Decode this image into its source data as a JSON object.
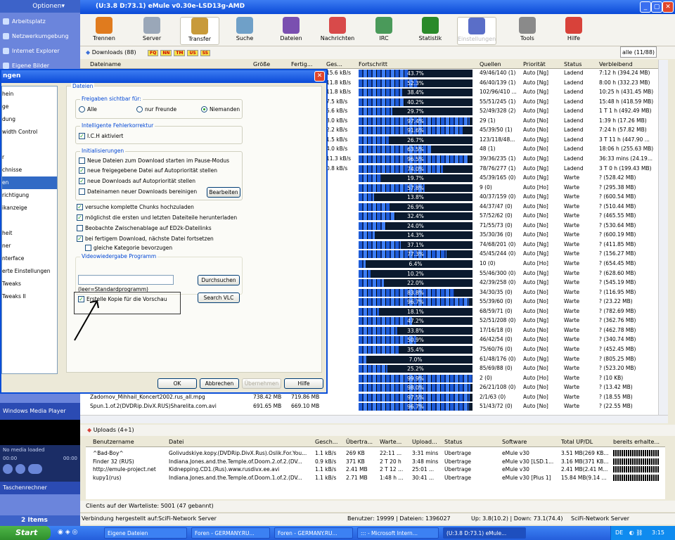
{
  "window": {
    "title": "(U:3.8 D:73.1) eMule v0.30e-LSD13g-AMD"
  },
  "explorer": {
    "optionen": "Optionen▾",
    "items": [
      "Arbeitsplatz",
      "Netzwerkumgebung",
      "Internet Explorer",
      "Eigene Bilder"
    ],
    "wmp_title": "Windows Media Player",
    "wmp_media": "No media loaded",
    "wmp_time_left": "00:00",
    "wmp_time_right": "00:00",
    "taschenrechner": "Taschenrechner",
    "items_count": "2 Items"
  },
  "toolbar": [
    "Trennen",
    "Server",
    "Transfer",
    "Suche",
    "Dateien",
    "Nachrichten",
    "IRC",
    "Statistik",
    "Einstellungen",
    "Tools",
    "Hilfe"
  ],
  "downloads": {
    "header": "Downloads (88)",
    "badges": [
      "FQ",
      "NN",
      "TM",
      "US",
      "SS"
    ],
    "filter": "alle (11/88)",
    "columns": [
      "Dateiname",
      "Größe",
      "Fertig...",
      "Ges...",
      "Fortschritt",
      "Quellen",
      "Priorität",
      "Status",
      "Verbleibend"
    ],
    "rows": [
      [
        "",
        "",
        "",
        "15.6 kB/s",
        "43.7%",
        "49/46/140 (1)",
        "Auto [Ng]",
        "Ladend",
        "7:12 h (394.24 MB)",
        43.7
      ],
      [
        "",
        "",
        "",
        "11.8 kB/s",
        "52.3%",
        "46/40/139 (1)",
        "Auto [Ng]",
        "Ladend",
        "8:00 h (332.23 MB)",
        52.3
      ],
      [
        "",
        "",
        "",
        "11.8 kB/s",
        "38.4%",
        "102/96/410 ...",
        "Auto [Ng]",
        "Ladend",
        "10:25 h (431.45 MB)",
        38.4
      ],
      [
        "",
        "",
        "",
        "7.5 kB/s",
        "40.2%",
        "55/51/245 (1)",
        "Auto [Ng]",
        "Ladend",
        "15:48 h (418.59 MB)",
        40.2
      ],
      [
        "",
        "",
        "",
        "5.6 kB/s",
        "29.7%",
        "52/49/328 (2)",
        "Auto [Ng]",
        "Ladend",
        "1 T 1 h (492.49 MB)",
        29.7
      ],
      [
        "",
        "",
        "",
        "3.0 kB/s",
        "97.4%",
        "29 (1)",
        "Auto [No]",
        "Ladend",
        "1:39 h (17.26 MB)",
        97.4
      ],
      [
        "",
        "",
        "",
        "2.2 kB/s",
        "91.6%",
        "45/39/50 (1)",
        "Auto [No]",
        "Ladend",
        "7:24 h (57.82 MB)",
        91.6
      ],
      [
        "",
        "",
        "",
        "1.5 kB/s",
        "26.7%",
        "123/118/48...",
        "Auto [Ng]",
        "Ladend",
        "3 T 11 h (447.90 ...",
        26.7
      ],
      [
        "",
        "",
        "",
        "4.0 kB/s",
        "63.5%",
        "48 (1)",
        "Auto [No]",
        "Ladend",
        "18:06 h (255.63 MB)",
        63.5
      ],
      [
        "",
        "",
        "",
        "11.3 kB/s",
        "96.5%",
        "39/36/235 (1)",
        "Auto [Ng]",
        "Ladend",
        "36:33 mins (24.19...",
        96.5
      ],
      [
        "",
        "",
        "",
        "0.8 kB/s",
        "74.0%",
        "78/76/277 (1)",
        "Auto [Ng]",
        "Ladend",
        "3 T 0 h (199.43 MB)",
        74.0
      ],
      [
        "",
        "",
        "",
        "",
        "19.7%",
        "45/39/165 (0)",
        "Auto [Ng]",
        "Warte",
        "? (528.42 MB)",
        19.7
      ],
      [
        "",
        "",
        "",
        "",
        "57.8%",
        "9 (0)",
        "Auto [Ho]",
        "Warte",
        "? (295.38 MB)",
        57.8
      ],
      [
        "",
        "",
        "",
        "",
        "13.8%",
        "40/37/159 (0)",
        "Auto [Ng]",
        "Warte",
        "? (600.54 MB)",
        13.8
      ],
      [
        "",
        "",
        "",
        "",
        "26.9%",
        "44/37/47 (0)",
        "Auto [No]",
        "Warte",
        "? (510.44 MB)",
        26.9
      ],
      [
        "",
        "",
        "",
        "",
        "32.4%",
        "57/52/62 (0)",
        "Auto [No]",
        "Warte",
        "? (465.55 MB)",
        32.4
      ],
      [
        "",
        "",
        "",
        "",
        "24.0%",
        "71/55/73 (0)",
        "Auto [No]",
        "Warte",
        "? (530.64 MB)",
        24.0
      ],
      [
        "",
        "",
        "",
        "",
        "14.3%",
        "35/30/36 (0)",
        "Auto [No]",
        "Warte",
        "? (600.19 MB)",
        14.3
      ],
      [
        "",
        "",
        "",
        "",
        "37.1%",
        "74/68/201 (0)",
        "Auto [Ng]",
        "Warte",
        "? (411.85 MB)",
        37.1
      ],
      [
        "",
        "",
        "",
        "",
        "77.3%",
        "45/45/244 (0)",
        "Auto [Ng]",
        "Warte",
        "? (156.27 MB)",
        77.3
      ],
      [
        "",
        "",
        "",
        "",
        "6.4%",
        "10 (0)",
        "Auto [Ho]",
        "Warte",
        "? (654.45 MB)",
        6.4
      ],
      [
        "",
        "",
        "",
        "",
        "10.2%",
        "55/46/300 (0)",
        "Auto [Ng]",
        "Warte",
        "? (628.60 MB)",
        10.2
      ],
      [
        "",
        "",
        "",
        "",
        "22.0%",
        "42/39/258 (0)",
        "Auto [Ng]",
        "Warte",
        "? (545.19 MB)",
        22.0
      ],
      [
        "",
        "",
        "",
        "",
        "83.8%",
        "34/30/35 (0)",
        "Auto [No]",
        "Warte",
        "? (116.95 MB)",
        83.8
      ],
      [
        "",
        "",
        "",
        "",
        "96.7%",
        "55/39/60 (0)",
        "Auto [No]",
        "Warte",
        "? (23.22 MB)",
        96.7
      ],
      [
        "",
        "",
        "",
        "",
        "18.1%",
        "68/59/71 (0)",
        "Auto [No]",
        "Warte",
        "? (782.69 MB)",
        18.1
      ],
      [
        "",
        "",
        "",
        "",
        "47.2%",
        "52/51/208 (0)",
        "Auto [Ng]",
        "Warte",
        "? (362.76 MB)",
        47.2
      ],
      [
        "",
        "",
        "",
        "",
        "33.8%",
        "17/16/18 (0)",
        "Auto [No]",
        "Warte",
        "? (462.78 MB)",
        33.8
      ],
      [
        "",
        "",
        "",
        "",
        "50.9%",
        "46/42/54 (0)",
        "Auto [No]",
        "Warte",
        "? (340.74 MB)",
        50.9
      ],
      [
        "",
        "",
        "",
        "",
        "35.4%",
        "75/60/76 (0)",
        "Auto [No]",
        "Warte",
        "? (452.45 MB)",
        35.4
      ],
      [
        "",
        "",
        "",
        "",
        "7.0%",
        "61/48/176 (0)",
        "Auto [Ng]",
        "Warte",
        "? (805.25 MB)",
        7.0
      ],
      [
        "",
        "",
        "",
        "",
        "25.2%",
        "85/69/88 (0)",
        "Auto [No]",
        "Warte",
        "? (523.20 MB)",
        25.2
      ],
      [
        "",
        "",
        "",
        "",
        "99.9%",
        "2 (0)",
        "Auto [Ho]",
        "Warte",
        "? (10 KB)",
        99.9
      ],
      [
        "",
        "",
        "",
        "",
        "98.0%",
        "26/21/108 (0)",
        "Auto [No]",
        "Warte",
        "? (13.42 MB)",
        98.0
      ],
      [
        "Zadornov_Mihhail_Koncert2002.rus_all.mpg",
        "738.42 MB",
        "719.86 MB",
        "",
        "97.5%",
        "2/1/63 (0)",
        "Auto [No]",
        "Warte",
        "? (18.55 MB)",
        97.5
      ],
      [
        "Spun.1.of.2(DVDRip.DivX.RUS)Sharelita.com.avi",
        "691.65 MB",
        "669.10 MB",
        "",
        "96.7%",
        "51/43/72 (0)",
        "Auto [No]",
        "Warte",
        "? (22.55 MB)",
        96.7
      ]
    ]
  },
  "uploads": {
    "header": "Uploads (4+1)",
    "columns": [
      "Benutzername",
      "Datei",
      "Gesch...",
      "Übertra...",
      "Warte...",
      "Upload...",
      "Status",
      "Software",
      "Total UP/DL",
      "bereits erhalte..."
    ],
    "rows": [
      [
        "^Bad-Boy^",
        "Golivudskiye.kopy.(DVDRip.DivX.Rus).Oslik.For.You...",
        "1.1 kB/s",
        "269 KB",
        "22:11 ...",
        "3:31 mins",
        "Übertrage",
        "eMule v30",
        "3.51 MB(269 KB..."
      ],
      [
        "Finder 32 (RUS)",
        "Indiana.Jones.and.the.Temple.of.Doom.2.of.2.(DV...",
        "0.9 kB/s",
        "371 KB",
        "2 T 20 h",
        "3:48 mins",
        "Übertrage",
        "eMule v30 [LSD.1...",
        "3.16 MB(371 KB..."
      ],
      [
        "http://emule-project.net",
        "Kidnepping.CD1.(Rus).www.rusdivx.ee.avi",
        "1.1 kB/s",
        "2.41 MB",
        "2 T 12 ...",
        "25:01 ...",
        "Übertrage",
        "eMule v30",
        "2.41 MB(2.41 M..."
      ],
      [
        "kupy1(rus)",
        "Indiana.Jones.and.the.Temple.of.Doom.1.of.2.(DV...",
        "1.1 kB/s",
        "2.71 MB",
        "1:48 h ...",
        "30:41 ...",
        "Übertrage",
        "eMule v30 [Plus 1]",
        "15.84 MB(9.14 ..."
      ]
    ]
  },
  "warteliste": "Clients auf der Warteliste:     5001 (47 gebannt)",
  "status": {
    "conn": "Verbindung hergestellt auf:SciFi-Network Server",
    "users": "Benutzer: 19999 | Dateien: 1396027",
    "updown": "Up: 3.8(10.2) | Down: 73.1(74.4)",
    "server": "SciFi-Network Server"
  },
  "dialog": {
    "title": "ngen",
    "nav": [
      "hein",
      "ge",
      "dung",
      "width Control",
      "",
      "r",
      "chnisse",
      "en",
      "richtigung",
      "ikanzeige",
      "",
      "heit",
      "ner",
      "nterface",
      "erte Einstellungen",
      "Tweaks",
      "Tweaks II"
    ],
    "page_title": "Dateien",
    "freigaben": "Freigaben sichtbar für:",
    "radios": [
      "Alle",
      "nur Freunde",
      "Niemanden"
    ],
    "ich_group": "Intelligente Fehlerkorrektur",
    "ich": "I.C.H aktiviert",
    "init_group": "Initialisierungen",
    "init": [
      "Neue Dateien zum Download starten im Pause-Modus",
      "neue freigegebene Datei auf Autopriorität stellen",
      "neue Downloads auf Autopriorität stellen",
      "Dateinamen neuer Downloads bereinigen"
    ],
    "bearbeiten": "Bearbeiten",
    "opts": [
      "versuche komplette Chunks hochzuladen",
      "möglichst die ersten und letzten Dateiteile herunterladen",
      "Beobachte Zwischenablage auf ED2k-Dateilinks",
      "bei fertigem Download, nächste Datei fortsetzen",
      "gleiche Kategorie bevorzugen"
    ],
    "video_group": "Videowiedergabe Programm",
    "durchsuchen": "Durchsuchen",
    "leer": "(leer=Standardprogramm)",
    "searchvlc": "Search VLC",
    "preview": "Erstelle Kopie für die Vorschau",
    "ok": "OK",
    "abbrechen": "Abbrechen",
    "uebernehmen": "Übernehmen",
    "hilfe": "Hilfe"
  },
  "taskbar": {
    "start": "Start",
    "tasks": [
      "Eigene Dateien",
      "Foren - GERMANY.RU...",
      "Foren - GERMANY.RU...",
      "::: - Microsoft Intern...",
      "(U:3.8 D:73.1) eMule..."
    ],
    "lang": "DE",
    "time": "3:15"
  }
}
